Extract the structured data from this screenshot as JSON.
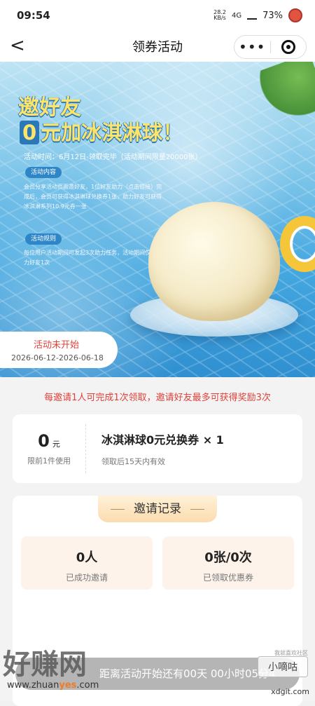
{
  "status_bar": {
    "time": "09:54",
    "net_speed": "28.2",
    "net_unit": "KB/s",
    "signal": "4G",
    "battery": "73%"
  },
  "nav": {
    "back_label": "<",
    "title": "领券活动",
    "more_label": "•••"
  },
  "hero": {
    "headline_line1": "邀好友",
    "headline_zero": "0",
    "headline_line2": "元加冰淇淋球！",
    "activity_time": "活动时间：6月12日-领取完毕（活动期间限量20000张）",
    "content_pill": "活动内容",
    "content_text": "会员分享活动页面邀好友，1位好友助力（点击链接）完成后，会员可获得冰淇淋球兑换券1张，助力好友可获得冰淇淋系列10.9元券一张",
    "rules_pill": "活动规则",
    "rules_text": "每位用户活动期间可发起3次助力任务，活动期间仅限助力好友1次",
    "status": "活动未开始",
    "date_range": "2026-06-12-2026-06-18"
  },
  "rule_line": "每邀请1人可完成1次领取，邀请好友最多可获得奖励3次",
  "coupon": {
    "amount": "0",
    "unit": "元",
    "limit": "限前1件使用",
    "name": "冰淇淋球0元兑换券 × 1",
    "validity": "领取后15天内有效"
  },
  "records": {
    "header": "邀请记录",
    "stats": [
      {
        "value": "0人",
        "label": "已成功邀请"
      },
      {
        "value": "0张/0次",
        "label": "已领取优惠券"
      }
    ]
  },
  "bottom_bar": "距离活动开始还有00天 00小时05分4",
  "watermark": {
    "text": "好赚网",
    "url_prefix": "www.zhuan",
    "url_accent": "yes",
    "url_suffix": ".com",
    "right_tag": "小嘀咕",
    "right_url": "xdgit.com",
    "right_small": "我就喜欢社区"
  }
}
